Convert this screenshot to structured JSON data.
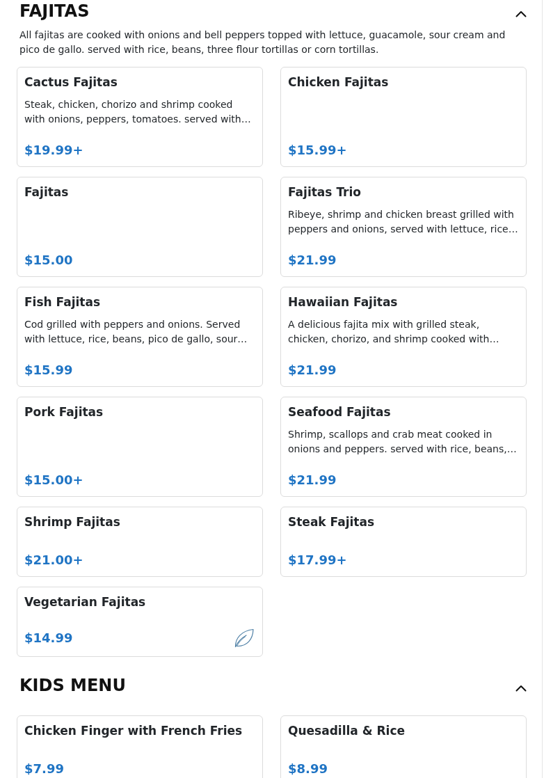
{
  "sections": [
    {
      "title": "FAJITAS",
      "expanded": true,
      "description": "All fajitas are cooked with onions and bell peppers topped with lettuce, guacamole, sour cream and pico de gallo. served with rice, beans, three flour tortillas or corn tortillas.",
      "items": [
        {
          "name": "Cactus Fajitas",
          "description": "Steak, chicken, chorizo and shrimp cooked with onions, peppers, tomatoes. served with…",
          "price": "$19.99+",
          "vegetarian": false
        },
        {
          "name": "Chicken Fajitas",
          "price": "$15.99+",
          "vegetarian": false
        },
        {
          "name": "Fajitas",
          "price": "$15.00",
          "vegetarian": false
        },
        {
          "name": "Fajitas Trio",
          "description": "Ribeye, shrimp and chicken breast grilled with peppers and onions, served with lettuce, rice…",
          "price": "$21.99",
          "vegetarian": false
        },
        {
          "name": "Fish Fajitas",
          "description": "Cod grilled with peppers and onions. Served with lettuce, rice, beans, pico de gallo, sour…",
          "price": "$15.99",
          "vegetarian": false
        },
        {
          "name": "Hawaiian Fajitas",
          "description": "A delicious fajita mix with grilled steak, chicken, chorizo, and shrimp cooked with…",
          "price": "$21.99",
          "vegetarian": false
        },
        {
          "name": "Pork Fajitas",
          "price": "$15.00+",
          "vegetarian": false
        },
        {
          "name": "Seafood Fajitas",
          "description": "Shrimp, scallops and crab meat cooked in onions and peppers. served with rice, beans,…",
          "price": "$21.99",
          "vegetarian": false
        },
        {
          "name": "Shrimp Fajitas",
          "price": "$21.00+",
          "vegetarian": false
        },
        {
          "name": "Steak Fajitas",
          "price": "$17.99+",
          "vegetarian": false
        },
        {
          "name": "Vegetarian Fajitas",
          "price": "$14.99",
          "vegetarian": true
        }
      ]
    },
    {
      "title": "KIDS MENU",
      "expanded": true,
      "items": [
        {
          "name": "Chicken Finger with French Fries",
          "price": "$7.99",
          "vegetarian": false
        },
        {
          "name": "Quesadilla & Rice",
          "price": "$8.99",
          "vegetarian": false
        }
      ]
    }
  ]
}
